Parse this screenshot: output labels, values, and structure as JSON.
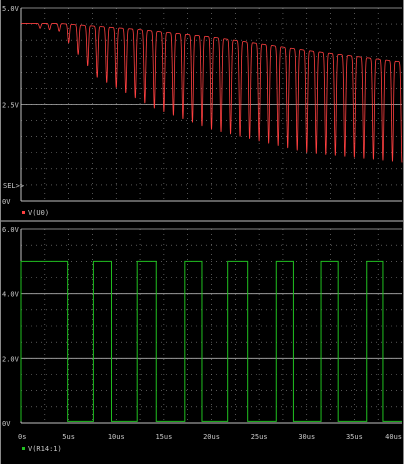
{
  "chart_data": [
    {
      "type": "line",
      "panel": "top",
      "ylim": [
        0,
        5.0
      ],
      "y_ticks": [
        {
          "label": "5.0V",
          "value": 5.0
        },
        {
          "label": "2.5V",
          "value": 2.5
        },
        {
          "label": "0V",
          "value": 0
        }
      ],
      "sel_marker": "SEL>>",
      "xlim": [
        0,
        40
      ],
      "grid": true,
      "series": [
        {
          "name": "V(U0)",
          "color": "#ff4040",
          "envelope_upper": [
            [
              0,
              4.6
            ],
            [
              4,
              4.6
            ],
            [
              12,
              4.45
            ],
            [
              20,
              4.25
            ],
            [
              30,
              3.9
            ],
            [
              40,
              3.6
            ]
          ],
          "envelope_lower": [
            [
              0,
              4.55
            ],
            [
              4,
              4.4
            ],
            [
              8,
              3.2
            ],
            [
              14,
              2.4
            ],
            [
              20,
              1.85
            ],
            [
              30,
              1.25
            ],
            [
              40,
              1.0
            ]
          ],
          "cycles": 40
        }
      ]
    },
    {
      "type": "line",
      "panel": "bottom",
      "ylim": [
        0,
        6.0
      ],
      "y_ticks": [
        {
          "label": "6.0V",
          "value": 6.0
        },
        {
          "label": "4.0V",
          "value": 4.0
        },
        {
          "label": "2.0V",
          "value": 2.0
        },
        {
          "label": "0V",
          "value": 0
        }
      ],
      "xlim": [
        0,
        40
      ],
      "x_ticks": [
        {
          "label": "0s",
          "value": 0
        },
        {
          "label": "5us",
          "value": 5
        },
        {
          "label": "10us",
          "value": 10
        },
        {
          "label": "15us",
          "value": 15
        },
        {
          "label": "20us",
          "value": 20
        },
        {
          "label": "25us",
          "value": 25
        },
        {
          "label": "30us",
          "value": 30
        },
        {
          "label": "35us",
          "value": 35
        },
        {
          "label": "40us",
          "value": 40
        }
      ],
      "grid": true,
      "series": [
        {
          "name": "V(R14:1)",
          "color": "#20c020",
          "high": 5.0,
          "low": 0.05,
          "high_segments": [
            [
              0,
              4.9
            ],
            [
              7.6,
              9.5
            ],
            [
              12.2,
              14.2
            ],
            [
              17.2,
              19.0
            ],
            [
              21.7,
              23.8
            ],
            [
              26.8,
              28.6
            ],
            [
              31.5,
              33.3
            ],
            [
              36.3,
              38.0
            ]
          ]
        }
      ]
    }
  ],
  "colors": {
    "background": "#000000",
    "grid": "#8a8a8a",
    "axis": "#c0c0c0",
    "border": "#bfbfbf"
  }
}
